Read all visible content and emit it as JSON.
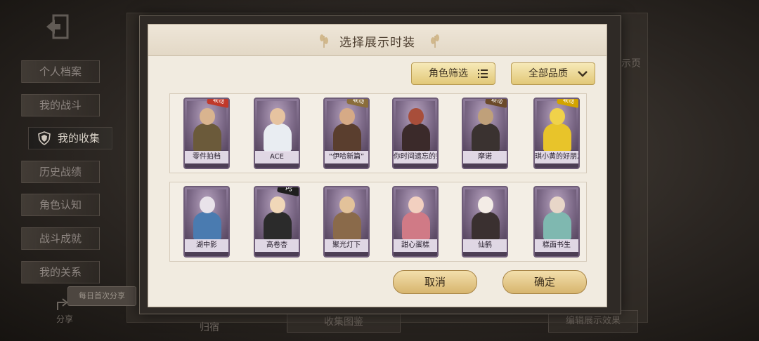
{
  "background": {
    "side_menu": [
      {
        "label": "个人档案",
        "active": false
      },
      {
        "label": "我的战斗",
        "active": false
      },
      {
        "label": "我的收集",
        "active": true
      },
      {
        "label": "历史战绩",
        "active": false
      },
      {
        "label": "角色认知",
        "active": false
      },
      {
        "label": "战斗成就",
        "active": false
      },
      {
        "label": "我的关系",
        "active": false
      }
    ],
    "share_bubble": "每日首次分享",
    "share_label": "分享",
    "right_text": "示页",
    "bottom_left_text": "归宿",
    "bottom_mid_text": "收集图鉴",
    "bottom_right_text": "编辑展示效果"
  },
  "dialog": {
    "title": "选择展示时装",
    "role_filter": "角色筛选",
    "quality_filter": "全部品质",
    "cancel_label": "取消",
    "confirm_label": "确定"
  },
  "costumes": [
    {
      "name": "零件拍档",
      "badge": "联动",
      "badge_color": "#c0392b",
      "skin": "#d9b48f",
      "outfit": "#6b5a3a"
    },
    {
      "name": "ACE",
      "badge": "",
      "badge_color": "",
      "skin": "#e6c3a0",
      "outfit": "#e9edf2"
    },
    {
      "name": "“伊哈新篇”",
      "badge": "联动",
      "badge_color": "#8a6d3b",
      "skin": "#d6aa86",
      "outfit": "#5a3e2e"
    },
    {
      "name": "你时间遗忘的男孩",
      "badge": "",
      "badge_color": "",
      "skin": "#a84e3a",
      "outfit": "#3b2a2a"
    },
    {
      "name": "摩诺",
      "badge": "联动",
      "badge_color": "#6b4a2a",
      "skin": "#bfa07a",
      "outfit": "#3a3230"
    },
    {
      "name": "琪小黄的好朋友",
      "badge": "联动",
      "badge_color": "#d2a400",
      "skin": "#f0d24a",
      "outfit": "#e8c42a"
    },
    {
      "name": "湖中影",
      "badge": "",
      "badge_color": "",
      "skin": "#e9e3ea",
      "outfit": "#4a7bb0"
    },
    {
      "name": "高卷杏",
      "badge": "P5",
      "badge_color": "#1e1e1e",
      "skin": "#f0d7b8",
      "outfit": "#2b2b2b"
    },
    {
      "name": "聚光灯下",
      "badge": "",
      "badge_color": "",
      "skin": "#e2c29a",
      "outfit": "#8a6a4a"
    },
    {
      "name": "甜心蛋糕",
      "badge": "",
      "badge_color": "",
      "skin": "#f2d0c0",
      "outfit": "#d07a86"
    },
    {
      "name": "仙鹤",
      "badge": "",
      "badge_color": "",
      "skin": "#f3ece6",
      "outfit": "#3a3030"
    },
    {
      "name": "糕面书生",
      "badge": "",
      "badge_color": "",
      "skin": "#e8d6c8",
      "outfit": "#7fb8b0"
    }
  ]
}
